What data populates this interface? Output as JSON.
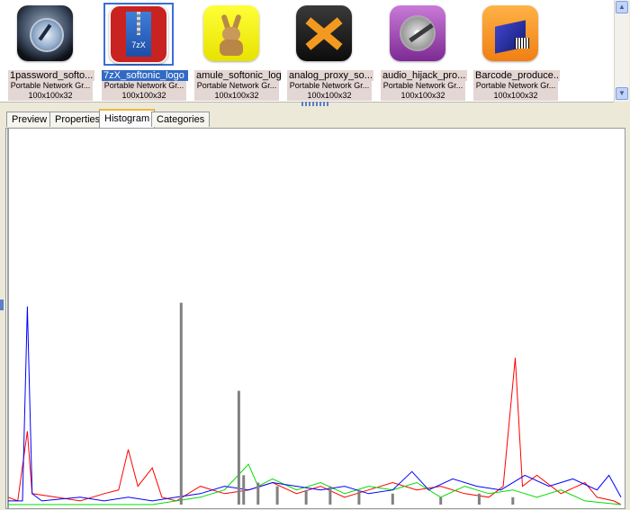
{
  "thumbnails": [
    {
      "name": "1password_softo...",
      "type": "Portable Network Gr...",
      "dims": "100x100x32",
      "icon": "lock-icon",
      "selected": false
    },
    {
      "name": "7zX_softonic_logo",
      "type": "Portable Network Gr...",
      "dims": "100x100x32",
      "icon": "zip-archive-icon",
      "icon_text": "7zX",
      "selected": true
    },
    {
      "name": "amule_softonic_logo",
      "type": "Portable Network Gr...",
      "dims": "100x100x32",
      "icon": "mule-mascot-icon",
      "selected": false
    },
    {
      "name": "analog_proxy_so...",
      "type": "Portable Network Gr...",
      "dims": "100x100x32",
      "icon": "x-logo-icon",
      "selected": false
    },
    {
      "name": "audio_hijack_pro...",
      "type": "Portable Network Gr...",
      "dims": "100x100x32",
      "icon": "audio-disc-icon",
      "selected": false
    },
    {
      "name": "Barcode_produce...",
      "type": "Portable Network Gr...",
      "dims": "100x100x32",
      "icon": "barcode-box-icon",
      "selected": false
    }
  ],
  "tabs": [
    {
      "label": "Preview",
      "active": false
    },
    {
      "label": "Properties",
      "active": false
    },
    {
      "label": "Histogram",
      "active": true
    },
    {
      "label": "Categories",
      "active": false
    }
  ],
  "chart_data": {
    "type": "line",
    "x_range": [
      0,
      255
    ],
    "y_range": [
      0,
      1
    ],
    "series": [
      {
        "color": "#ff0000",
        "values": [
          [
            0,
            0.02
          ],
          [
            4,
            0.01
          ],
          [
            8,
            0.2
          ],
          [
            10,
            0.03
          ],
          [
            20,
            0.02
          ],
          [
            30,
            0.01
          ],
          [
            40,
            0.03
          ],
          [
            46,
            0.04
          ],
          [
            50,
            0.15
          ],
          [
            54,
            0.05
          ],
          [
            60,
            0.1
          ],
          [
            64,
            0.02
          ],
          [
            70,
            0.01
          ],
          [
            80,
            0.05
          ],
          [
            90,
            0.03
          ],
          [
            100,
            0.04
          ],
          [
            110,
            0.06
          ],
          [
            120,
            0.03
          ],
          [
            130,
            0.05
          ],
          [
            140,
            0.02
          ],
          [
            150,
            0.04
          ],
          [
            160,
            0.06
          ],
          [
            170,
            0.04
          ],
          [
            180,
            0.05
          ],
          [
            190,
            0.03
          ],
          [
            200,
            0.02
          ],
          [
            206,
            0.05
          ],
          [
            211,
            0.4
          ],
          [
            214,
            0.05
          ],
          [
            220,
            0.08
          ],
          [
            230,
            0.03
          ],
          [
            240,
            0.06
          ],
          [
            245,
            0.02
          ],
          [
            252,
            0.01
          ],
          [
            255,
            0.0
          ]
        ]
      },
      {
        "color": "#00dd00",
        "values": [
          [
            0,
            0.0
          ],
          [
            60,
            0.0
          ],
          [
            70,
            0.01
          ],
          [
            80,
            0.02
          ],
          [
            90,
            0.04
          ],
          [
            100,
            0.11
          ],
          [
            104,
            0.05
          ],
          [
            110,
            0.07
          ],
          [
            120,
            0.04
          ],
          [
            130,
            0.06
          ],
          [
            140,
            0.03
          ],
          [
            150,
            0.05
          ],
          [
            160,
            0.04
          ],
          [
            170,
            0.06
          ],
          [
            180,
            0.02
          ],
          [
            190,
            0.05
          ],
          [
            200,
            0.03
          ],
          [
            210,
            0.04
          ],
          [
            220,
            0.02
          ],
          [
            230,
            0.04
          ],
          [
            240,
            0.01
          ],
          [
            255,
            0.0
          ]
        ]
      },
      {
        "color": "#0000ff",
        "values": [
          [
            0,
            0.01
          ],
          [
            6,
            0.01
          ],
          [
            8,
            0.54
          ],
          [
            10,
            0.03
          ],
          [
            14,
            0.01
          ],
          [
            30,
            0.02
          ],
          [
            40,
            0.01
          ],
          [
            50,
            0.02
          ],
          [
            60,
            0.01
          ],
          [
            70,
            0.02
          ],
          [
            80,
            0.03
          ],
          [
            90,
            0.05
          ],
          [
            100,
            0.04
          ],
          [
            110,
            0.06
          ],
          [
            120,
            0.05
          ],
          [
            130,
            0.04
          ],
          [
            140,
            0.05
          ],
          [
            150,
            0.03
          ],
          [
            160,
            0.04
          ],
          [
            168,
            0.09
          ],
          [
            175,
            0.04
          ],
          [
            185,
            0.07
          ],
          [
            195,
            0.05
          ],
          [
            205,
            0.04
          ],
          [
            215,
            0.08
          ],
          [
            225,
            0.05
          ],
          [
            235,
            0.07
          ],
          [
            245,
            0.04
          ],
          [
            250,
            0.08
          ],
          [
            255,
            0.02
          ]
        ]
      },
      {
        "color": "#808080",
        "kind": "bars",
        "values": [
          [
            72,
            0.55
          ],
          [
            96,
            0.31
          ],
          [
            98,
            0.08
          ],
          [
            104,
            0.06
          ],
          [
            112,
            0.05
          ],
          [
            124,
            0.04
          ],
          [
            134,
            0.05
          ],
          [
            146,
            0.04
          ],
          [
            160,
            0.03
          ],
          [
            180,
            0.02
          ],
          [
            196,
            0.03
          ],
          [
            210,
            0.02
          ]
        ]
      }
    ]
  }
}
